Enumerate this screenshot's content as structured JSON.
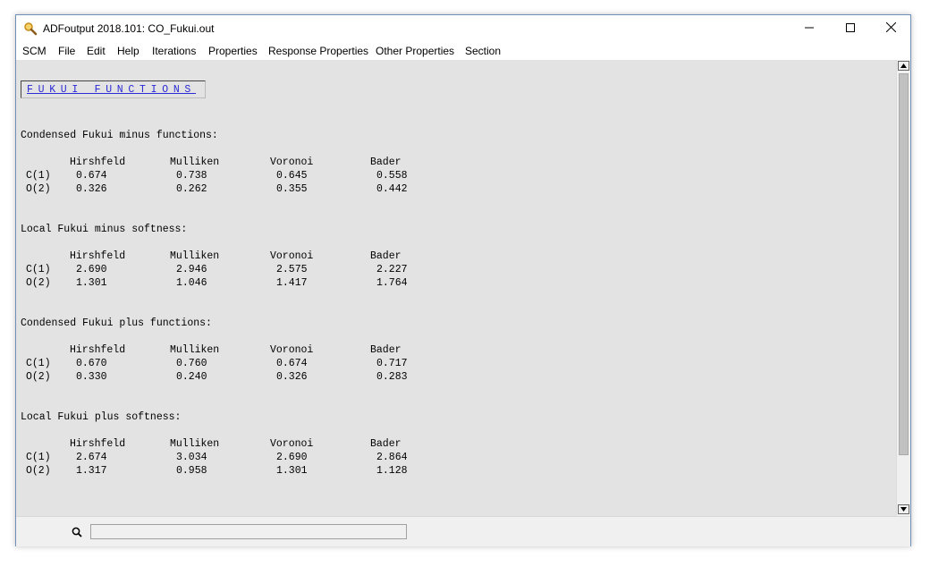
{
  "window": {
    "title": "ADFoutput 2018.101: CO_Fukui.out"
  },
  "menu": [
    "SCM",
    "File",
    "Edit",
    "Help",
    "Iterations",
    "Properties",
    "Response Properties",
    "Other Properties",
    "Section"
  ],
  "heading": "FUKUI FUNCTIONS",
  "columns": [
    "Hirshfeld",
    "Mulliken",
    "Voronoi",
    "Bader"
  ],
  "sections": [
    {
      "title": "Condensed Fukui minus functions:",
      "rows": [
        {
          "atom": "C(1)",
          "values": [
            "0.674",
            "0.738",
            "0.645",
            "0.558"
          ]
        },
        {
          "atom": "O(2)",
          "values": [
            "0.326",
            "0.262",
            "0.355",
            "0.442"
          ]
        }
      ]
    },
    {
      "title": "Local Fukui minus softness:",
      "rows": [
        {
          "atom": "C(1)",
          "values": [
            "2.690",
            "2.946",
            "2.575",
            "2.227"
          ]
        },
        {
          "atom": "O(2)",
          "values": [
            "1.301",
            "1.046",
            "1.417",
            "1.764"
          ]
        }
      ]
    },
    {
      "title": "Condensed Fukui plus functions:",
      "rows": [
        {
          "atom": "C(1)",
          "values": [
            "0.670",
            "0.760",
            "0.674",
            "0.717"
          ]
        },
        {
          "atom": "O(2)",
          "values": [
            "0.330",
            "0.240",
            "0.326",
            "0.283"
          ]
        }
      ]
    },
    {
      "title": "Local Fukui plus softness:",
      "rows": [
        {
          "atom": "C(1)",
          "values": [
            "2.674",
            "3.034",
            "2.690",
            "2.864"
          ]
        },
        {
          "atom": "O(2)",
          "values": [
            "1.317",
            "0.958",
            "1.301",
            "1.128"
          ]
        }
      ]
    }
  ],
  "search": {
    "value": "",
    "placeholder": ""
  },
  "icons": {
    "app": "magnifier-icon",
    "search": "search-icon",
    "minimize": "minimize-icon",
    "maximize": "maximize-icon",
    "close": "close-icon"
  }
}
